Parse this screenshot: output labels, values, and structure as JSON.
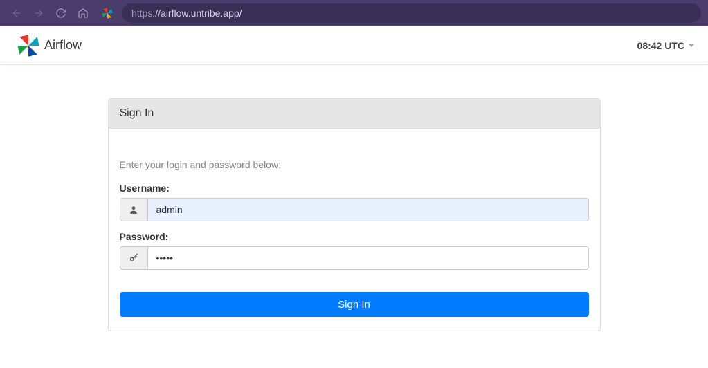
{
  "browser": {
    "url_proto": "https",
    "url_rest": "://airflow.untribe.app/"
  },
  "header": {
    "brand": "Airflow",
    "clock": "08:42 UTC"
  },
  "panel": {
    "title": "Sign In",
    "instruction": "Enter your login and password below:",
    "username_label": "Username:",
    "username_value": "admin",
    "password_label": "Password:",
    "password_value": "•••••",
    "submit_label": "Sign In"
  }
}
